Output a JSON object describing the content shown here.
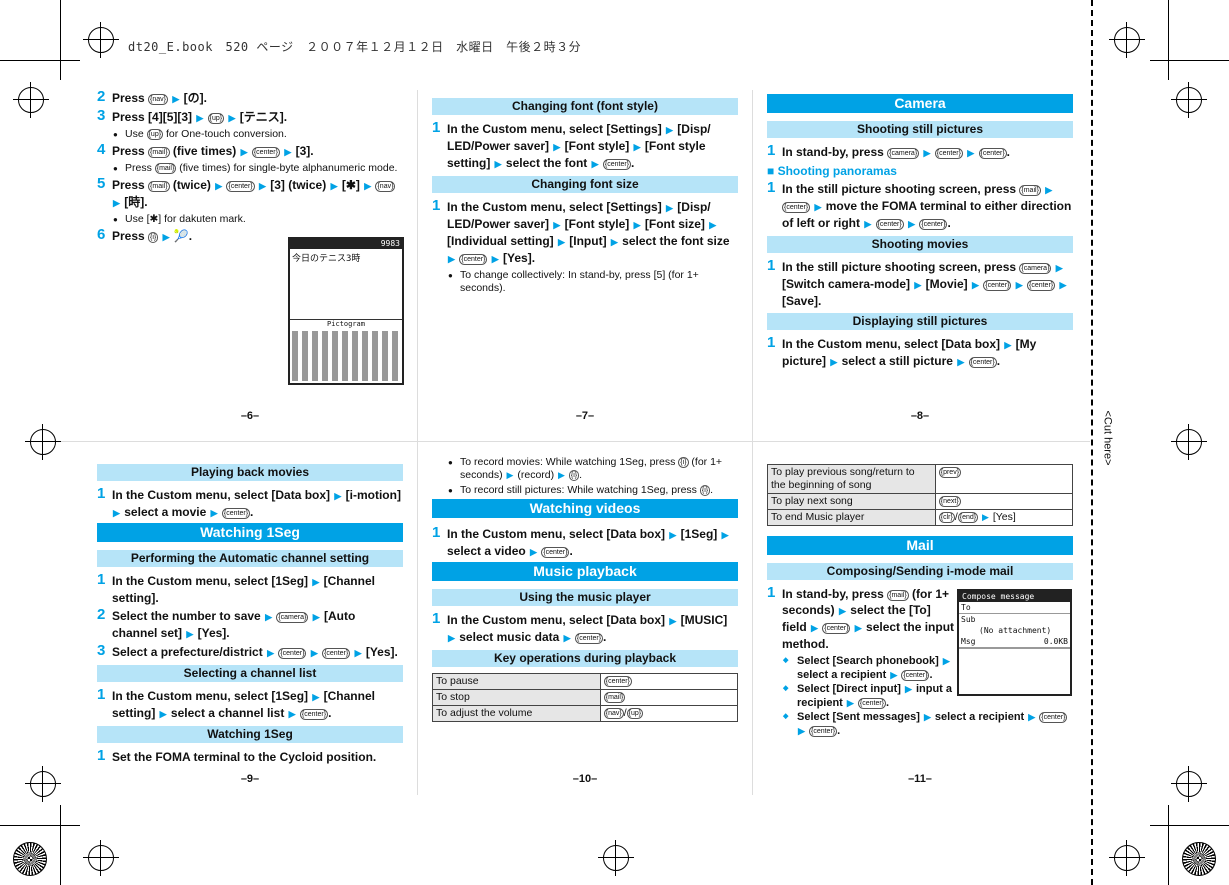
{
  "header": "dt20_E.book　520 ページ　２００７年１２月１２日　水曜日　午後２時３分",
  "cut_label": "<Cut here>",
  "page_numbers": [
    "–6–",
    "–7–",
    "–8–",
    "–9–",
    "–10–",
    "–11–"
  ],
  "icons": {
    "nav": "navigation-key",
    "center": "center-key",
    "mail": "mail-key",
    "i": "i-appli-key",
    "camera": "camera-key",
    "clr": "clear-key",
    "end": "end-key",
    "star": "asterisk-key",
    "up": "up-rotate-key",
    "prev": "rewind-key",
    "next": "forward-key"
  },
  "colors": {
    "heading": "#00a2e5",
    "subheading": "#b6e4f8"
  },
  "panels": [
    {
      "blocks": [
        {
          "t": "step",
          "n": "2",
          "parts": "Press {nav} ▶ [の]."
        },
        {
          "t": "step",
          "n": "3",
          "parts": "Press [4][5][3] ▶ {up} ▶ [テニス]."
        },
        {
          "t": "bul",
          "parts": "Use {up} for One-touch conversion."
        },
        {
          "t": "step",
          "n": "4",
          "parts": "Press {mail} (five times) ▶ {center} ▶ [3]."
        },
        {
          "t": "bul",
          "parts": "Press {mail} (five times) for single-byte alphanumeric mode."
        },
        {
          "t": "step",
          "n": "5",
          "parts": "Press {mail} (twice) ▶ {center} ▶ [3] (twice) ▶ [✱] ▶ {nav} ▶ [時]."
        },
        {
          "t": "bul",
          "parts": "Use [✱] for dakuten mark."
        },
        {
          "t": "step",
          "n": "6",
          "parts": "Press {i} ▶ 🎾."
        }
      ],
      "phone": {
        "status": "9983",
        "text": "今日のテニス3時",
        "label": "Pictogram"
      }
    },
    {
      "blocks": [
        {
          "t": "h2",
          "parts": "Changing font (font style)"
        },
        {
          "t": "step",
          "n": "1",
          "parts": "In the Custom menu, select [Settings] ▶ [Disp/ LED/Power saver] ▶ [Font style] ▶ [Font style setting] ▶ select the font ▶ {center}."
        },
        {
          "t": "h2",
          "parts": "Changing font size"
        },
        {
          "t": "step",
          "n": "1",
          "parts": "In the Custom menu, select [Settings] ▶ [Disp/ LED/Power saver] ▶ [Font style] ▶ [Font size] ▶ [Individual setting] ▶ [Input] ▶ select the font size ▶ {center} ▶ [Yes]."
        },
        {
          "t": "bul",
          "parts": "To change collectively: In stand-by, press [5] (for 1+ seconds)."
        }
      ]
    },
    {
      "blocks": [
        {
          "t": "h1",
          "parts": "Camera"
        },
        {
          "t": "h2",
          "parts": "Shooting still pictures"
        },
        {
          "t": "step",
          "n": "1",
          "parts": "In stand-by, press {camera} ▶ {center} ▶ {center}."
        },
        {
          "t": "sub",
          "parts": "■ Shooting panoramas"
        },
        {
          "t": "step",
          "n": "1",
          "parts": "In the still picture shooting screen, press {mail} ▶ {center} ▶ move the FOMA terminal to either direction of left or right ▶ {center} ▶ {center}."
        },
        {
          "t": "h2",
          "parts": "Shooting movies"
        },
        {
          "t": "step",
          "n": "1",
          "parts": "In the still picture shooting screen, press {camera} ▶ [Switch camera-mode] ▶ [Movie] ▶ {center} ▶ {center} ▶ [Save]."
        },
        {
          "t": "h2",
          "parts": "Displaying still pictures"
        },
        {
          "t": "step",
          "n": "1",
          "parts": "In the Custom menu, select [Data box] ▶ [My picture] ▶ select a still picture ▶ {center}."
        }
      ]
    },
    {
      "blocks": [
        {
          "t": "h2",
          "parts": "Playing back movies"
        },
        {
          "t": "step",
          "n": "1",
          "parts": "In the Custom menu, select [Data box] ▶ [i-motion] ▶ select a movie ▶ {center}."
        },
        {
          "t": "h1",
          "parts": "Watching 1Seg"
        },
        {
          "t": "h2",
          "parts": "Performing the Automatic channel setting"
        },
        {
          "t": "step",
          "n": "1",
          "parts": "In the Custom menu, select [1Seg] ▶ [Channel setting]."
        },
        {
          "t": "step",
          "n": "2",
          "parts": "Select the number to save ▶ {camera} ▶ [Auto channel set] ▶ [Yes]."
        },
        {
          "t": "step",
          "n": "3",
          "parts": "Select a prefecture/district ▶ {center} ▶ {center} ▶ [Yes]."
        },
        {
          "t": "h2",
          "parts": "Selecting a channel list"
        },
        {
          "t": "step",
          "n": "1",
          "parts": "In the Custom menu, select [1Seg] ▶ [Channel setting] ▶ select a channel list ▶ {center}."
        },
        {
          "t": "h2",
          "parts": "Watching 1Seg"
        },
        {
          "t": "step",
          "n": "1",
          "parts": "Set the FOMA terminal to the Cycloid position."
        }
      ]
    },
    {
      "blocks": [
        {
          "t": "bul",
          "parts": "To record movies: While watching 1Seg, press {i} (for 1+ seconds) ▶ (record) ▶ {i}."
        },
        {
          "t": "bul",
          "parts": "To record still pictures: While watching 1Seg, press {i}."
        },
        {
          "t": "h1",
          "parts": "Watching videos"
        },
        {
          "t": "step",
          "n": "1",
          "parts": "In the Custom menu, select [Data box] ▶ [1Seg] ▶ select a video ▶ {center}."
        },
        {
          "t": "h1",
          "parts": "Music playback"
        },
        {
          "t": "h2",
          "parts": "Using the music player"
        },
        {
          "t": "step",
          "n": "1",
          "parts": "In the Custom menu, select [Data box] ▶ [MUSIC] ▶ select music data ▶ {center}."
        },
        {
          "t": "h2",
          "parts": "Key operations during playback"
        },
        {
          "t": "table",
          "rows": [
            [
              "To pause",
              "{center}"
            ],
            [
              "To stop",
              "{mail}"
            ],
            [
              "To adjust the volume",
              "{nav}/{up}"
            ]
          ]
        }
      ]
    },
    {
      "blocks": [
        {
          "t": "table",
          "rows": [
            [
              "To play previous song/return to the beginning of song",
              "{prev}"
            ],
            [
              "To play next song",
              "{next}"
            ],
            [
              "To end Music player",
              "{clr}/{end} ▶ [Yes]"
            ]
          ]
        },
        {
          "t": "h1",
          "parts": "Mail"
        },
        {
          "t": "h2",
          "parts": "Composing/Sending i-mode mail"
        },
        {
          "t": "step",
          "n": "1",
          "parts": "In stand-by, press {mail} (for 1+ seconds) ▶ select the [To] field ▶ {center} ▶ select the input method.",
          "narrow": true
        },
        {
          "t": "dia",
          "parts": "Select [Search phonebook] ▶ select a recipient ▶ {center}.",
          "narrow": true
        },
        {
          "t": "dia",
          "parts": "Select [Direct input] ▶ input a recipient ▶ {center}.",
          "narrow": true
        },
        {
          "t": "dia",
          "parts": "Select [Sent messages] ▶ select a recipient ▶ {center} ▶ {center}."
        }
      ],
      "phone": {
        "title": "Compose message",
        "to": "To",
        "sub": "Sub",
        "attach": "(No attachment)",
        "msg": "Msg",
        "size": "0.0KB"
      }
    }
  ]
}
